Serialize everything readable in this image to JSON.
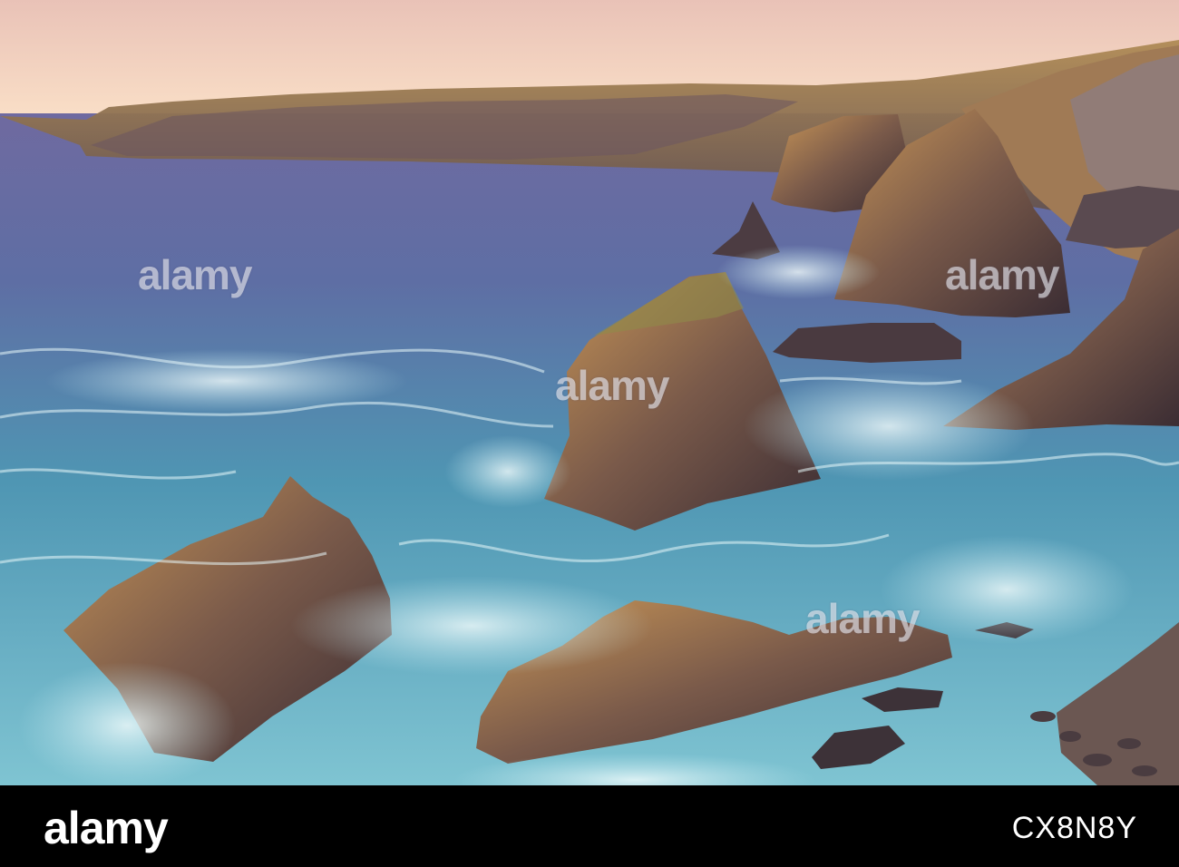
{
  "scene": {
    "description_icon": "coastal-landscape",
    "colors": {
      "sky_top": "#f2c9b8",
      "sky_horizon": "#f9dcc4",
      "sea_deep": "#5b5f96",
      "sea_mid": "#3d90a8",
      "surf": "#cfeef2",
      "rock_lit": "#b8864a",
      "rock_shadow": "#3e2f33",
      "cliff": "#8a6b4e"
    }
  },
  "watermarks": [
    "alamy",
    "alamy",
    "alamy",
    "alamy"
  ],
  "footer": {
    "logo": "alamy",
    "image_id": "CX8N8Y"
  }
}
